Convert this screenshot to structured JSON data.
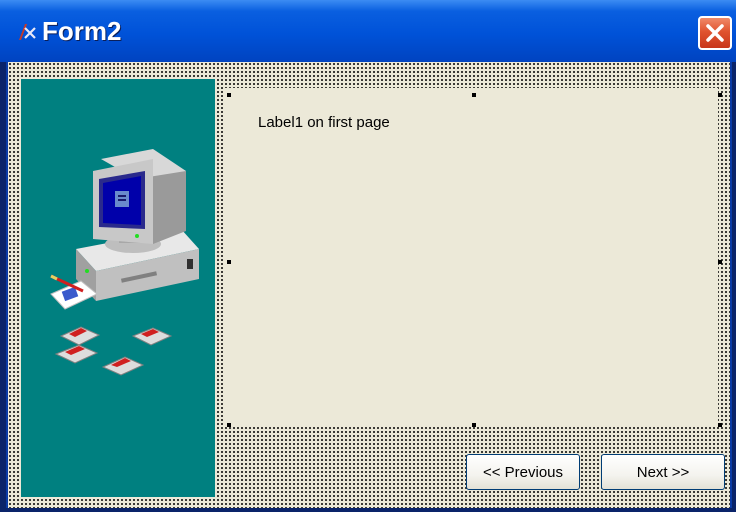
{
  "window": {
    "title": "Form2",
    "close_icon": "close-icon",
    "app_icon": "delphi-app-icon"
  },
  "wizard": {
    "side_image": "computer-with-floppy-disks-illustration",
    "page_label": "Label1 on first page",
    "previous_label": "<< Previous",
    "next_label": "Next >>"
  },
  "colors": {
    "titlebar": "#0052D8",
    "client": "#ECE9D8",
    "side_panel": "#008080",
    "close_button": "#E05430"
  }
}
